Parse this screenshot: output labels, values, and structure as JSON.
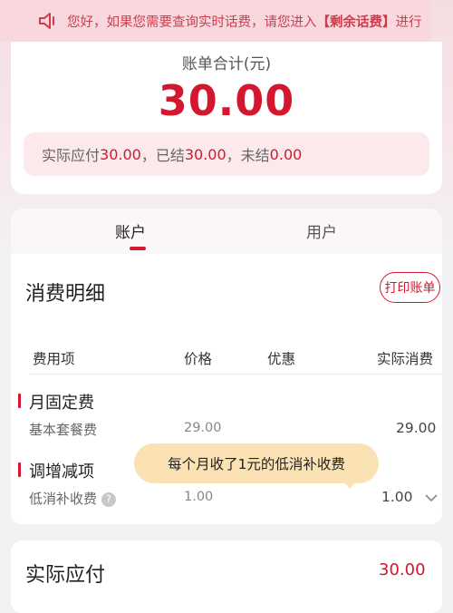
{
  "banner": {
    "icon": "speaker-icon",
    "text_lead": "您好，如果您需要查询实时话费，请您进入",
    "link": "【剩余话费】",
    "text_tail": "进行"
  },
  "summary": {
    "label": "账单合计(元)",
    "amount": "30.00",
    "status_label_1": "实际应付",
    "status_value_1": "30.00",
    "status_sep_1": "，已结",
    "status_value_2": "30.00",
    "status_sep_2": "，未结",
    "status_value_3": "0.00"
  },
  "tabs": [
    {
      "label": "账户",
      "active": true
    },
    {
      "label": "用户",
      "active": false
    }
  ],
  "detail": {
    "title": "消费明细",
    "print_button": "打印账单",
    "columns": [
      "费用项",
      "价格",
      "优惠",
      "实际消费"
    ],
    "sections": [
      {
        "title": "月固定费",
        "rows": [
          {
            "item": "基本套餐费",
            "price": "29.00",
            "discount": "",
            "actual": "29.00"
          }
        ]
      },
      {
        "title": "调增减项",
        "rows": [
          {
            "item": "低消补收费",
            "price": "1.00",
            "discount": "",
            "actual": "1.00"
          }
        ]
      }
    ],
    "help_icon": "question-icon",
    "expand_icon": "chevron-down-icon"
  },
  "tooltip": "每个月收了1元的低消补收费",
  "actual_payable": {
    "label": "实际应付",
    "value": "30.00"
  },
  "colors": {
    "accent": "#d4172f",
    "banner_bg": "#f8d8dd",
    "bubble_bg": "#fbe2b5"
  }
}
